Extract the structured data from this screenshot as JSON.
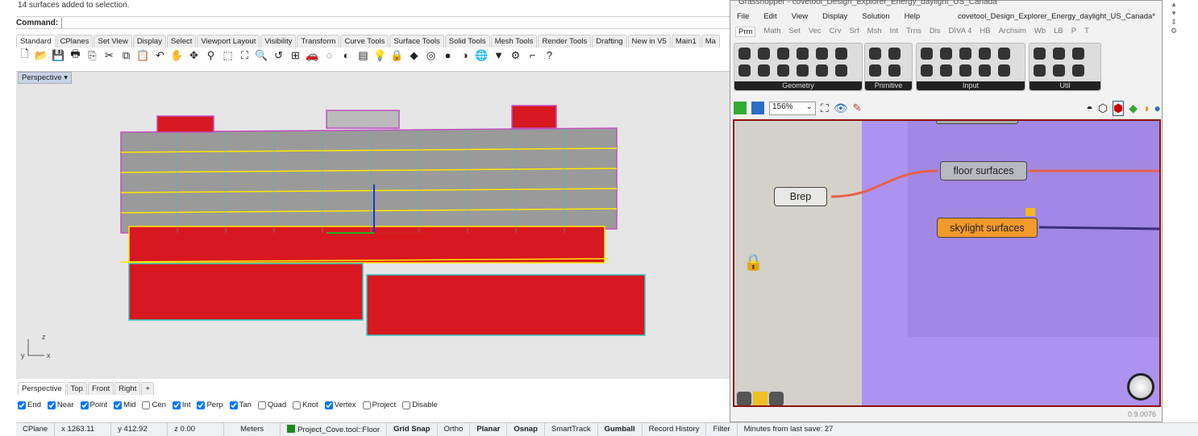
{
  "command_history": "14 surfaces added to selection.",
  "command": {
    "label": "Command:",
    "value": ""
  },
  "toolbar_tabs": [
    "Standard",
    "CPlanes",
    "Set View",
    "Display",
    "Select",
    "Viewport Layout",
    "Visibility",
    "Transform",
    "Curve Tools",
    "Surface Tools",
    "Solid Tools",
    "Mesh Tools",
    "Render Tools",
    "Drafting",
    "New in V5",
    "Main1",
    "Ma"
  ],
  "toolbar_icons": [
    {
      "n": "new-file",
      "g": "🗋"
    },
    {
      "n": "open-folder",
      "g": "📂"
    },
    {
      "n": "save",
      "g": "💾"
    },
    {
      "n": "print",
      "g": "🖶"
    },
    {
      "n": "import",
      "g": "⎘"
    },
    {
      "n": "cut",
      "g": "✂"
    },
    {
      "n": "copy",
      "g": "⧉"
    },
    {
      "n": "paste",
      "g": "📋"
    },
    {
      "n": "undo",
      "g": "↶"
    },
    {
      "n": "pan",
      "g": "✋"
    },
    {
      "n": "rotate",
      "g": "✥"
    },
    {
      "n": "zoom",
      "g": "⚲"
    },
    {
      "n": "zoom-window",
      "g": "⬚"
    },
    {
      "n": "zoom-extents",
      "g": "⛶"
    },
    {
      "n": "zoom-selected",
      "g": "🔍"
    },
    {
      "n": "undo-view",
      "g": "↺"
    },
    {
      "n": "viewports",
      "g": "⊞"
    },
    {
      "n": "car",
      "g": "🚗"
    },
    {
      "n": "hide",
      "g": "◌"
    },
    {
      "n": "show",
      "g": "◐"
    },
    {
      "n": "layers",
      "g": "▤"
    },
    {
      "n": "light",
      "g": "💡"
    },
    {
      "n": "lock",
      "g": "🔒"
    },
    {
      "n": "material",
      "g": "◆"
    },
    {
      "n": "color-wheel",
      "g": "◎"
    },
    {
      "n": "render-sphere",
      "g": "●"
    },
    {
      "n": "render-preview",
      "g": "◑"
    },
    {
      "n": "globe",
      "g": "🌐"
    },
    {
      "n": "filter",
      "g": "▼"
    },
    {
      "n": "options",
      "g": "⚙"
    },
    {
      "n": "dimension",
      "g": "⌐"
    },
    {
      "n": "help",
      "g": "?"
    }
  ],
  "viewport": {
    "label": "Perspective",
    "tabs": [
      "Perspective",
      "Top",
      "Front",
      "Right",
      "+"
    ],
    "axes": {
      "x": "x",
      "y": "y",
      "z": "z"
    }
  },
  "osnaps": [
    {
      "l": "End",
      "c": true
    },
    {
      "l": "Near",
      "c": true
    },
    {
      "l": "Point",
      "c": true
    },
    {
      "l": "Mid",
      "c": true
    },
    {
      "l": "Cen",
      "c": false
    },
    {
      "l": "Int",
      "c": true
    },
    {
      "l": "Perp",
      "c": true
    },
    {
      "l": "Tan",
      "c": true
    },
    {
      "l": "Quad",
      "c": false
    },
    {
      "l": "Knot",
      "c": false
    },
    {
      "l": "Vertex",
      "c": true
    },
    {
      "l": "Project",
      "c": false
    },
    {
      "l": "Disable",
      "c": false
    }
  ],
  "status": {
    "cplane": "CPlane",
    "x": "x 1263.11",
    "y": "y 412.92",
    "z": "z 0.00",
    "units": "Meters",
    "layer": "Project_Cove.tool::Floor",
    "layer_color": "#1a8a1a",
    "toggles": [
      {
        "l": "Grid Snap",
        "b": true
      },
      {
        "l": "Ortho",
        "b": false
      },
      {
        "l": "Planar",
        "b": true
      },
      {
        "l": "Osnap",
        "b": true
      },
      {
        "l": "SmartTrack",
        "b": false
      },
      {
        "l": "Gumball",
        "b": true
      },
      {
        "l": "Record History",
        "b": false
      },
      {
        "l": "Filter",
        "b": false
      }
    ],
    "message": "Minutes from last save: 27"
  },
  "grasshopper": {
    "title": "Grasshopper - covetool_Design_Explorer_Energy_daylight_US_Canada",
    "menu": [
      "File",
      "Edit",
      "View",
      "Display",
      "Solution",
      "Help"
    ],
    "file": "covetool_Design_Explorer_Energy_daylight_US_Canada*",
    "tabs": [
      "Prm",
      "Math",
      "Set",
      "Vec",
      "Crv",
      "Srf",
      "Msh",
      "Int",
      "Trns",
      "Dis",
      "DIVA 4",
      "HB",
      "Archsim",
      "Wb",
      "LB",
      "P",
      "T"
    ],
    "panels": [
      "Geometry",
      "Primitive",
      "Input",
      "Util"
    ],
    "zoom": "156%",
    "nodes": {
      "brep": "Brep",
      "floor": "floor surfaces",
      "skylight": "skylight surfaces"
    },
    "version": "0.9.0076",
    "colors": {
      "group": "#ab8ff0",
      "canvas": "#d4d1cb",
      "wire": "#e8604e",
      "skylight": "#f39a2b",
      "border": "#8b1212"
    }
  }
}
